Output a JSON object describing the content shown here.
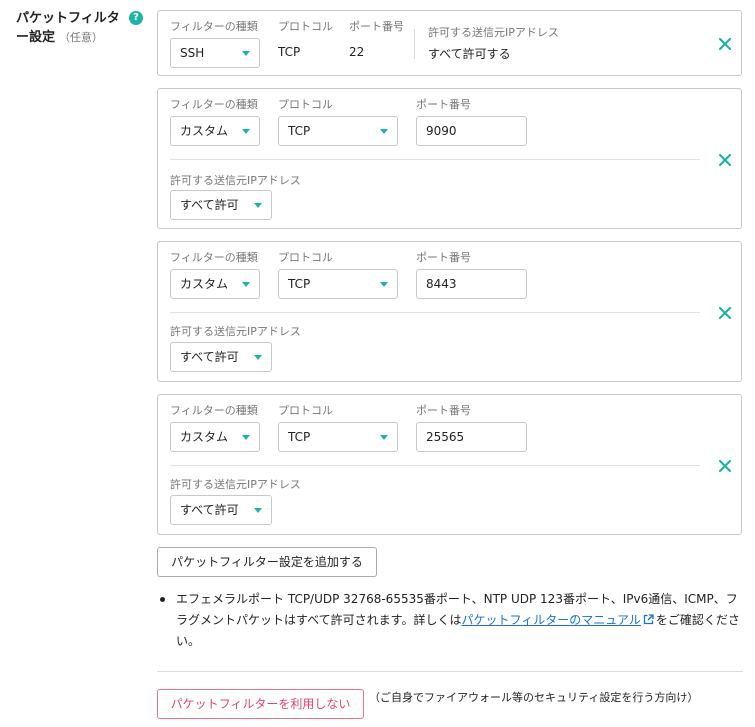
{
  "section": {
    "label_line1": "パケットフィルタ",
    "label_line2": "ー設定",
    "optional": "（任意）",
    "help_glyph": "?"
  },
  "filters": [
    {
      "type_label": "フィルターの種類",
      "type_value": "SSH",
      "protocol_label": "プロトコル",
      "protocol_value": "TCP",
      "port_label": "ポート番号",
      "port_value": "22",
      "source_label": "許可する送信元IPアドレス",
      "source_value": "すべて許可する"
    },
    {
      "type_label": "フィルターの種類",
      "type_value": "カスタム",
      "protocol_label": "プロトコル",
      "protocol_value": "TCP",
      "port_label": "ポート番号",
      "port_value": "9090",
      "source_label": "許可する送信元IPアドレス",
      "source_value": "すべて許可"
    },
    {
      "type_label": "フィルターの種類",
      "type_value": "カスタム",
      "protocol_label": "プロトコル",
      "protocol_value": "TCP",
      "port_label": "ポート番号",
      "port_value": "8443",
      "source_label": "許可する送信元IPアドレス",
      "source_value": "すべて許可"
    },
    {
      "type_label": "フィルターの種類",
      "type_value": "カスタム",
      "protocol_label": "プロトコル",
      "protocol_value": "TCP",
      "port_label": "ポート番号",
      "port_value": "25565",
      "source_label": "許可する送信元IPアドレス",
      "source_value": "すべて許可"
    }
  ],
  "add_button": "パケットフィルター設定を追加する",
  "note": {
    "text_before": "エフェメラルポート TCP/UDP 32768-65535番ポート、NTP UDP 123番ポート、IPv6通信、ICMP、フラグメントパケットはすべて許可されます。詳しくは",
    "link_text": "パケットフィルターのマニュアル",
    "text_after": "をご確認ください。"
  },
  "disable_button": "パケットフィルターを利用しない",
  "disable_note": "（ご自身でファイアウォール等のセキュリティ設定を行う方向け）",
  "colors": {
    "accent": "#1fb2a6",
    "danger": "#e0436a",
    "link": "#1a6fcf"
  },
  "icons": {
    "close": "close-icon",
    "help": "help-icon",
    "external": "external-link-icon",
    "dropdown": "chevron-down-icon"
  }
}
